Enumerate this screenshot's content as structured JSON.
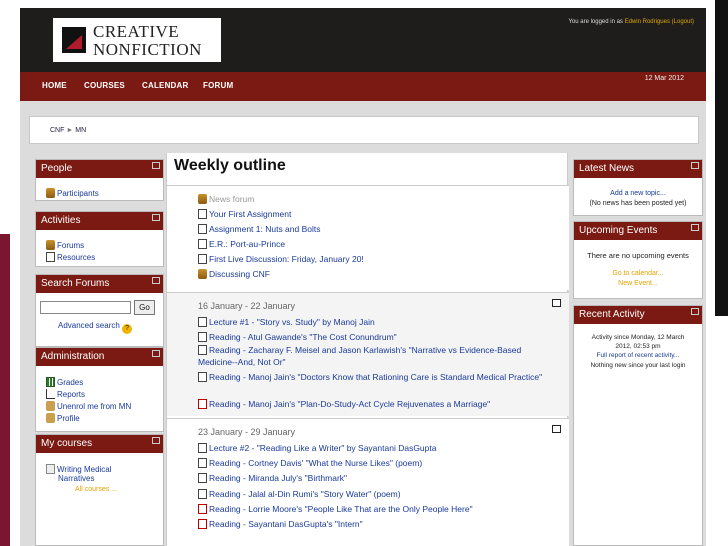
{
  "header": {
    "logo_line1": "CREATIVE",
    "logo_line2": "NONFICTION",
    "login_prefix": "You are logged in as",
    "login_user": "Edwin Rodrigues",
    "logout_label": "(Logout)",
    "date": "12 Mar 2012"
  },
  "nav": [
    "HOME",
    "COURSES",
    "CALENDAR",
    "FORUM"
  ],
  "breadcrumb": {
    "root": "CNF",
    "separator": "►",
    "current": "MN"
  },
  "left": {
    "people": {
      "title": "People",
      "items": [
        "Participants"
      ]
    },
    "activities": {
      "title": "Activities",
      "items": [
        "Forums",
        "Resources"
      ]
    },
    "search": {
      "title": "Search Forums",
      "go": "Go",
      "advanced": "Advanced search",
      "help": "?"
    },
    "admin": {
      "title": "Administration",
      "items": [
        "Grades",
        "Reports",
        "Unenrol me from MN",
        "Profile"
      ]
    },
    "courses": {
      "title": "My courses",
      "course_line1": "Writing Medical",
      "course_line2": "Narratives",
      "all": "All courses ..."
    }
  },
  "main": {
    "title": "Weekly outline",
    "sections": [
      {
        "date": "",
        "items": [
          {
            "text": "News forum",
            "icon": "forum-icon"
          },
          {
            "text": "Your First Assignment",
            "icon": "document-icon"
          },
          {
            "text": "Assignment 1: Nuts and Bolts",
            "icon": "document-icon"
          },
          {
            "text": "E.R.: Port-au-Prince",
            "icon": "document-icon"
          },
          {
            "text": "First Live Discussion: Friday, January 20!",
            "icon": "document-icon"
          },
          {
            "text": "Discussing CNF",
            "icon": "forum-icon"
          }
        ]
      },
      {
        "date": "16 January - 22 January",
        "items": [
          {
            "text": "Lecture #1 - \"Story vs. Study\" by Manoj Jain",
            "icon": "document-icon"
          },
          {
            "text": "Reading - Atul Gawande's \"The Cost Conundrum\"",
            "icon": "document-icon"
          },
          {
            "text": "Reading - Zacharay F. Meisel and Jason Karlawish's \"Narrative vs Evidence-Based Medicine--And, Not Or\"",
            "icon": "document-icon"
          },
          {
            "text": "Reading - Manoj Jain's \"Doctors Know that Rationing Care is Standard Medical Practice\"",
            "icon": "document-icon"
          },
          {
            "text": "Reading - Manoj Jain's \"Plan-Do-Study-Act Cycle Rejuvenates a Marriage\"",
            "icon": "pdf-icon"
          }
        ]
      },
      {
        "date": "23 January - 29 January",
        "items": [
          {
            "text": "Lecture #2 - \"Reading Like a Writer\" by Sayantani DasGupta",
            "icon": "document-icon"
          },
          {
            "text": "Reading - Cortney Davis' \"What the Nurse Likes\" (poem)",
            "icon": "document-icon"
          },
          {
            "text": "Reading - Miranda July's \"Birthmark\"",
            "icon": "document-icon"
          },
          {
            "text": "Reading - Jalal al-Din Rumi's \"Story Water\" (poem)",
            "icon": "document-icon"
          },
          {
            "text": "Reading - Lorrie Moore's \"People Like That are the Only People Here\"",
            "icon": "pdf-icon"
          },
          {
            "text": "Reading - Sayantani DasGupta's \"Intern\"",
            "icon": "pdf-icon"
          }
        ]
      }
    ]
  },
  "right": {
    "news": {
      "title": "Latest News",
      "add": "Add a new topic...",
      "none": "(No news has been posted yet)"
    },
    "events": {
      "title": "Upcoming Events",
      "none": "There are no upcoming events",
      "calendar": "Go to calendar...",
      "new_event": "New Event..."
    },
    "recent": {
      "title": "Recent Activity",
      "since1": "Activity since Monday, 12 March",
      "since2": "2012, 02:53 pm",
      "report": "Full report of recent activity...",
      "nothing": "Nothing new since your last login"
    }
  },
  "colors": {
    "header_bg": "#1e1d1c",
    "nav_bg": "#7a1a12",
    "block_head": "#7a1a12",
    "link": "#1a3a9a",
    "accent": "#e0a400"
  }
}
